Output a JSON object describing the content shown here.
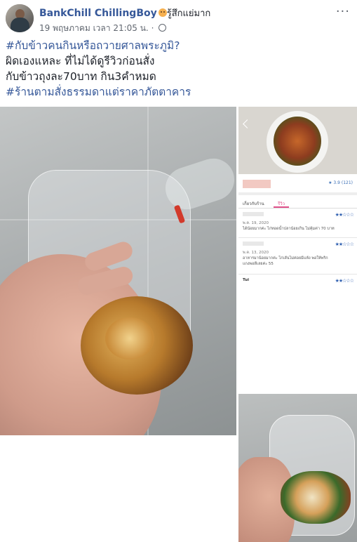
{
  "post": {
    "author": "BankChill ChillingBoy",
    "feeling": "รู้สึกแย่มาก",
    "date": "19 พฤษภาคม เวลา 21:05 น.",
    "separator": "·",
    "more": "···",
    "lines": [
      {
        "text": "#กับข้าวคนกินหรือถวายศาลพระภูมิ?",
        "hashtag": true
      },
      {
        "text": "ผิดเองแหละ ที่ไม่ได้ดูรีวิวก่อนสั่ง",
        "hashtag": false
      },
      {
        "text": "กับข้าวถุงละ70บาท กิน3คำหมด",
        "hashtag": false
      },
      {
        "text": "#ร้านตามสั่งธรรมดาแต่ราคาภัตตาคาร",
        "hashtag": true
      }
    ]
  },
  "app_screenshot": {
    "rating": "★ 3.9 (121)",
    "tab_info": "เกี่ยวกับร้าน",
    "tab_reviews": "รีวิว",
    "stars": "★★☆☆☆",
    "reviews": [
      {
        "date": "พ.ค. 19, 2020",
        "text": "ได้น้อยมากค่ะ ไก่ทอดน้ำปลาน้อยเกิน ไม่คุ้มค่า 70 บาท"
      },
      {
        "date": "พ.ค. 13, 2020",
        "text": "อาหารมาน้อยมากค่ะ ไก่เส้นไม่ค่อยมีแห้ง พอให้พริกแกงพอดีเลยค่ะ 55"
      },
      {
        "date": "",
        "text": "Tui"
      }
    ]
  },
  "colors": {
    "link": "#365899",
    "text": "#1d2129",
    "meta": "#616770"
  }
}
